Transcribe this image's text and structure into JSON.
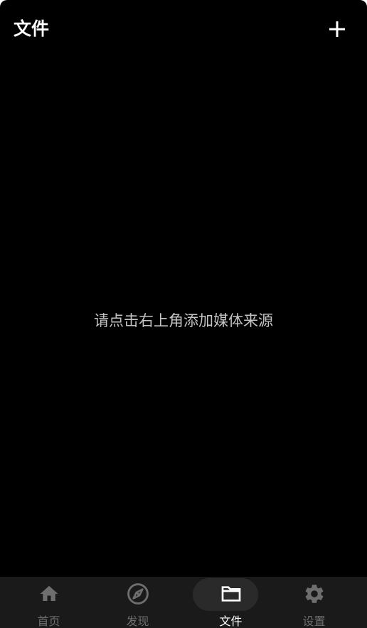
{
  "header": {
    "title": "文件",
    "add_icon": "plus-icon"
  },
  "empty_state": {
    "message": "请点击右上角添加媒体来源"
  },
  "bottom_nav": {
    "active_index": 2,
    "items": [
      {
        "label": "首页",
        "icon": "home-icon"
      },
      {
        "label": "发现",
        "icon": "compass-icon"
      },
      {
        "label": "文件",
        "icon": "folder-icon"
      },
      {
        "label": "设置",
        "icon": "gear-icon"
      }
    ]
  },
  "colors": {
    "background": "#000000",
    "nav_background": "#1a1a1a",
    "active_pill": "#2a2a2a",
    "inactive": "#6e6e6e",
    "active": "#ffffff",
    "message_text": "#c4c4c4"
  }
}
